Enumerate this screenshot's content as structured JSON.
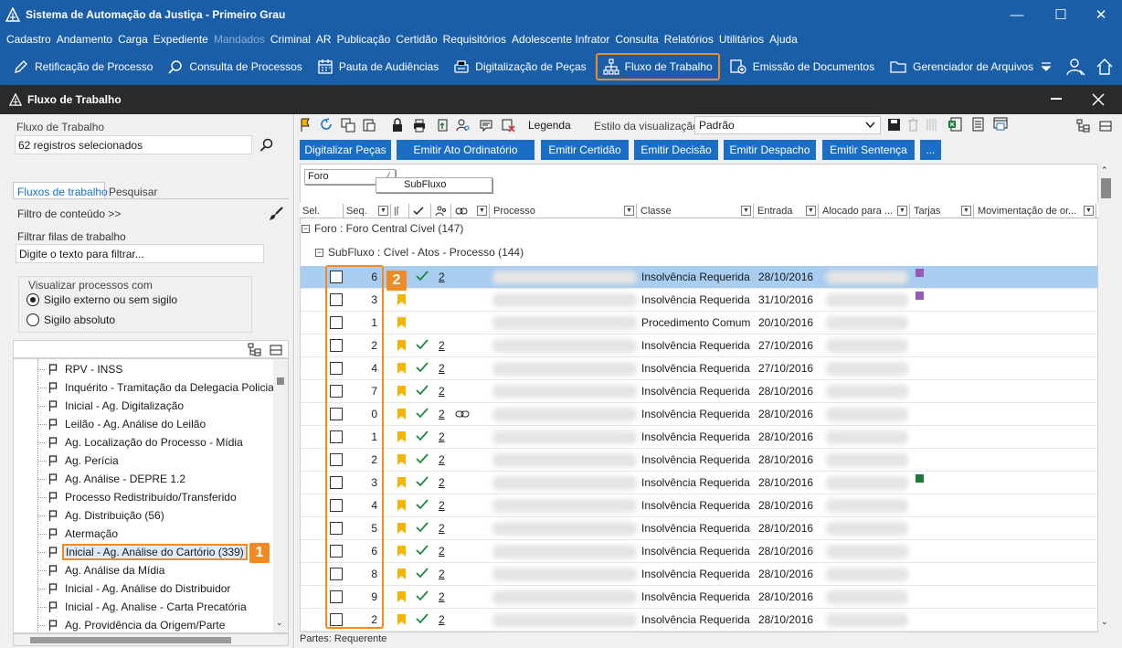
{
  "window": {
    "title": "Sistema de Automação da Justiça - Primeiro Grau",
    "min": "—",
    "max": "☐",
    "close": "✕"
  },
  "menu": [
    "Cadastro",
    "Andamento",
    "Carga",
    "Expediente",
    "Mandados",
    "Criminal",
    "AR",
    "Publicação",
    "Certidão",
    "Requisitórios",
    "Adolescente Infrator",
    "Consulta",
    "Relatórios",
    "Utilitários",
    "Ajuda"
  ],
  "menu_disabled_index": 4,
  "toolbar": {
    "items": [
      "Retificação de Processo",
      "Consulta de Processos",
      "Pauta de Audiências",
      "Digitalização de Peças",
      "Fluxo de Trabalho",
      "Emissão de Documentos",
      "Gerenciador de Arquivos"
    ]
  },
  "inner": {
    "title": "Fluxo de Trabalho"
  },
  "left": {
    "fluxo_label": "Fluxo de Trabalho",
    "fluxo_value": "62 registros selecionados",
    "tab_fluxos": "Fluxos de trabalho",
    "tab_pesquisar": "Pesquisar",
    "filtro_conteudo": "Filtro de conteúdo >>",
    "filtrar_label": "Filtrar filas de trabalho",
    "filtrar_placeholder": "Digite o texto para filtrar...",
    "visualizar_label": "Visualizar processos com",
    "radio1": "Sigilo externo ou sem sigilo",
    "radio2": "Sigilo absoluto",
    "tree": [
      "RPV - INSS",
      "Inquérito - Tramitação da Delegacia Policia",
      "Inicial - Ag. Digitalização",
      "Leilão - Ag. Análise do Leilão",
      "Ag. Localização do Processo - Mídia",
      "Ag. Perícia",
      "Ag. Análise - DEPRE 1.2",
      "Processo Redistribuído/Transferido",
      "Ag. Distribuição (56)",
      "Atermação",
      "Inicial - Ag. Análise do Cartório (339)",
      "Ag. Análise da Mídia",
      "Inicial  - Ag. Análise do Distribuidor",
      "Inicial - Ag. Analise - Carta Precatória",
      "Ag. Providência da Origem/Parte"
    ],
    "selected_index": 10,
    "badge1": "1"
  },
  "right": {
    "legenda": "Legenda",
    "estilo_label": "Estilo da visualização",
    "estilo_value": "Padrão",
    "buttons": [
      "Digitalizar Peças",
      "Emitir Ato Ordinatório",
      "Emitir Certidão",
      "Emitir Decisão",
      "Emitir Despacho",
      "Emitir Sentença",
      "..."
    ],
    "group_foro": "Foro",
    "group_subfluxo": "SubFluxo",
    "columns": [
      "Sel.",
      "Seq.",
      "",
      "",
      "",
      "",
      "Processo",
      "Classe",
      "Entrada",
      "Alocado para ...",
      "Tarjas",
      "Movimentação de or..."
    ],
    "group1": "Foro : Foro Central Cível  (147)",
    "group2": "SubFluxo : Cível - Atos - Processo  (144)",
    "badge2": "2",
    "status": "Partes: Requerente"
  },
  "rows": [
    {
      "seq": "6",
      "flag": false,
      "tick": true,
      "num": "2",
      "link": false,
      "classe": "Insolvência Requerida",
      "entrada": "28/10/2016",
      "tarja": "#9b59b6",
      "selected": true
    },
    {
      "seq": "3",
      "flag": true,
      "tick": false,
      "num": "",
      "link": false,
      "classe": "Insolvência Requerida",
      "entrada": "31/10/2016",
      "tarja": "#9b59b6",
      "selected": false
    },
    {
      "seq": "1",
      "flag": true,
      "tick": false,
      "num": "",
      "link": false,
      "classe": "Procedimento Comum",
      "entrada": "20/10/2016",
      "tarja": "",
      "selected": false
    },
    {
      "seq": "2",
      "flag": true,
      "tick": true,
      "num": "2",
      "link": false,
      "classe": "Insolvência Requerida",
      "entrada": "27/10/2016",
      "tarja": "",
      "selected": false
    },
    {
      "seq": "4",
      "flag": true,
      "tick": true,
      "num": "2",
      "link": false,
      "classe": "Insolvência Requerida",
      "entrada": "27/10/2016",
      "tarja": "",
      "selected": false
    },
    {
      "seq": "7",
      "flag": true,
      "tick": true,
      "num": "2",
      "link": false,
      "classe": "Insolvência Requerida",
      "entrada": "28/10/2016",
      "tarja": "",
      "selected": false
    },
    {
      "seq": "0",
      "flag": true,
      "tick": true,
      "num": "2",
      "link": true,
      "classe": "Insolvência Requerida",
      "entrada": "28/10/2016",
      "tarja": "",
      "selected": false
    },
    {
      "seq": "1",
      "flag": true,
      "tick": true,
      "num": "2",
      "link": false,
      "classe": "Insolvência Requerida",
      "entrada": "28/10/2016",
      "tarja": "",
      "selected": false
    },
    {
      "seq": "2",
      "flag": true,
      "tick": true,
      "num": "2",
      "link": false,
      "classe": "Insolvência Requerida",
      "entrada": "28/10/2016",
      "tarja": "",
      "selected": false
    },
    {
      "seq": "3",
      "flag": true,
      "tick": true,
      "num": "2",
      "link": false,
      "classe": "Insolvência Requerida",
      "entrada": "28/10/2016",
      "tarja": "#1a7a3a",
      "selected": false
    },
    {
      "seq": "4",
      "flag": true,
      "tick": true,
      "num": "2",
      "link": false,
      "classe": "Insolvência Requerida",
      "entrada": "28/10/2016",
      "tarja": "",
      "selected": false
    },
    {
      "seq": "5",
      "flag": true,
      "tick": true,
      "num": "2",
      "link": false,
      "classe": "Insolvência Requerida",
      "entrada": "28/10/2016",
      "tarja": "",
      "selected": false
    },
    {
      "seq": "6",
      "flag": true,
      "tick": true,
      "num": "2",
      "link": false,
      "classe": "Insolvência Requerida",
      "entrada": "28/10/2016",
      "tarja": "",
      "selected": false
    },
    {
      "seq": "8",
      "flag": true,
      "tick": true,
      "num": "2",
      "link": false,
      "classe": "Insolvência Requerida",
      "entrada": "28/10/2016",
      "tarja": "",
      "selected": false
    },
    {
      "seq": "9",
      "flag": true,
      "tick": true,
      "num": "2",
      "link": false,
      "classe": "Insolvência Requerida",
      "entrada": "28/10/2016",
      "tarja": "",
      "selected": false
    },
    {
      "seq": "2",
      "flag": true,
      "tick": true,
      "num": "2",
      "link": false,
      "classe": "Insolvência Requerida",
      "entrada": "28/10/2016",
      "tarja": "",
      "selected": false
    }
  ],
  "colors": {
    "brand": "#1a5ea8",
    "accent": "#f08a24",
    "selected_row": "#a9cdf0",
    "button": "#1a6fc4"
  }
}
